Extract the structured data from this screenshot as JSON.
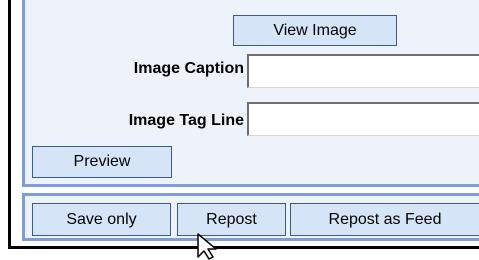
{
  "form": {
    "view_image_label": "View Image",
    "image_caption_label": "Image Caption",
    "image_caption_value": "",
    "image_tag_line_label": "Image Tag Line",
    "image_tag_line_value": "",
    "preview_label": "Preview"
  },
  "actions": {
    "save_only_label": "Save only",
    "repost_label": "Repost",
    "repost_as_feed_label": "Repost as Feed"
  },
  "colors": {
    "panel_border": "#7f9dd6",
    "panel_bg": "#edf2fb",
    "button_bg": "#d6e4f8",
    "button_border": "#3b5a8e"
  },
  "cursor": "arrow-pointer-icon"
}
